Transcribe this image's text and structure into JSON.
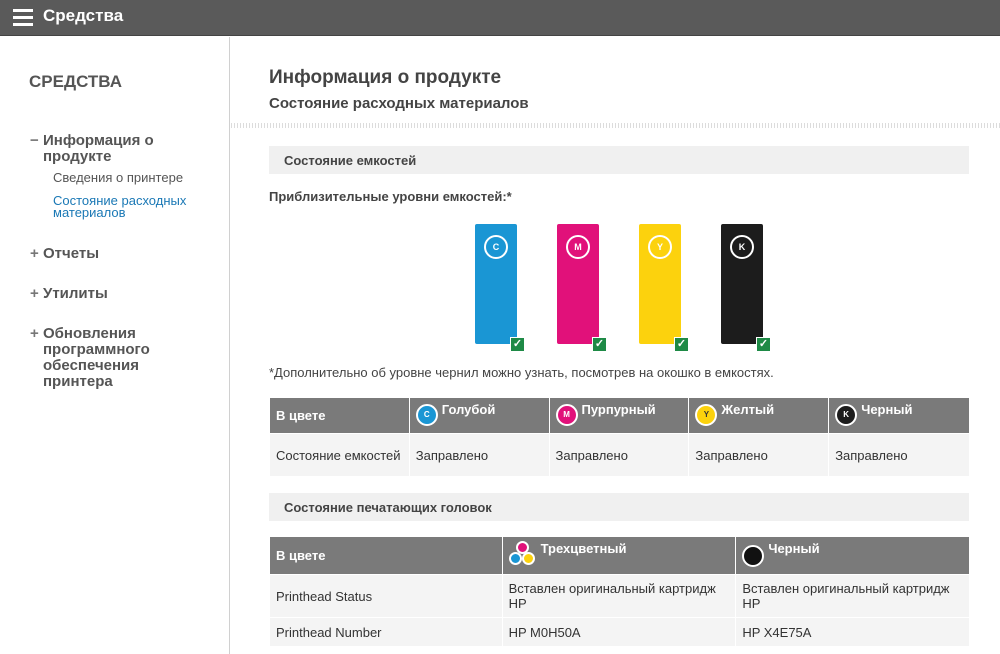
{
  "topbar": {
    "title": "Средства"
  },
  "sidebar": {
    "heading": "СРЕДСТВА",
    "groups": [
      {
        "sign": "−",
        "label": "Информация о продукте",
        "items": [
          "Сведения о принтере",
          "Состояние расходных материалов"
        ]
      },
      {
        "sign": "+",
        "label": "Отчеты"
      },
      {
        "sign": "+",
        "label": "Утилиты"
      },
      {
        "sign": "+",
        "label": "Обновления программного обеспечения принтера"
      }
    ]
  },
  "main": {
    "title": "Информация о продукте",
    "subtitle": "Состояние расходных материалов",
    "cartridge_section": "Состояние емкостей",
    "levels_label": "Приблизительные уровни емкостей:*",
    "cartridges": [
      {
        "letter": "C",
        "color": "#1a96d4",
        "level": 1.0,
        "status": "ok"
      },
      {
        "letter": "M",
        "color": "#e1117a",
        "level": 1.0,
        "status": "ok"
      },
      {
        "letter": "Y",
        "color": "#fcd20d",
        "level": 1.0,
        "status": "ok"
      },
      {
        "letter": "K",
        "color": "#1c1c1c",
        "level": 1.0,
        "status": "ok"
      }
    ],
    "footnote": "*Дополнительно об уровне чернил можно узнать, посмотрев на окошко в емкостях.",
    "cart_table": {
      "header": "В цвете",
      "columns": [
        "Голубой",
        "Пурпурный",
        "Желтый",
        "Черный"
      ],
      "row_label": "Состояние емкостей",
      "values": [
        "Заправлено",
        "Заправлено",
        "Заправлено",
        "Заправлено"
      ]
    },
    "printhead_section": "Состояние печатающих головок",
    "ph_table": {
      "header": "В цвете",
      "columns": [
        "Трехцветный",
        "Черный"
      ],
      "rows": [
        {
          "label": "Printhead Status",
          "values": [
            "Вставлен оригинальный картридж HP",
            "Вставлен оригинальный картридж HP"
          ]
        },
        {
          "label": "Printhead Number",
          "values": [
            "HP M0H50A",
            "HP X4E75A"
          ]
        }
      ]
    }
  }
}
